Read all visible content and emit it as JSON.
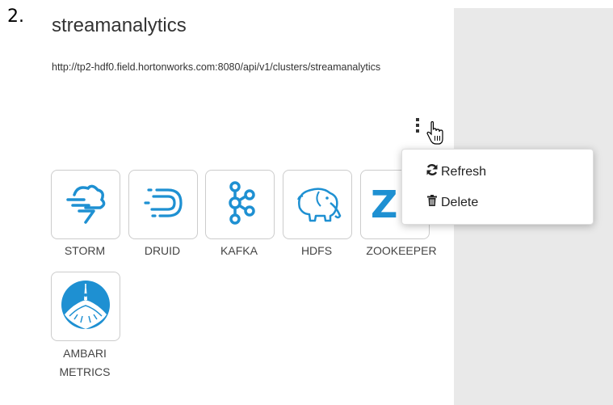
{
  "step_number": "2.",
  "cluster": {
    "name": "streamanalytics",
    "url": "http://tp2-hdf0.field.hortonworks.com:8080/api/v1/clusters/streamanalytics"
  },
  "menu": {
    "items": [
      {
        "label": "Refresh",
        "icon": "refresh-icon"
      },
      {
        "label": "Delete",
        "icon": "trash-icon"
      }
    ]
  },
  "services": [
    {
      "label": "STORM",
      "icon": "storm-icon"
    },
    {
      "label": "DRUID",
      "icon": "druid-icon"
    },
    {
      "label": "KAFKA",
      "icon": "kafka-icon"
    },
    {
      "label": "HDFS",
      "icon": "hdfs-elephant-icon"
    },
    {
      "label": "ZOOKEEPER",
      "icon": "zookeeper-icon",
      "logo_text": "ZK"
    },
    {
      "label_line1": "AMBARI",
      "label_line2": "METRICS",
      "icon": "ambari-metrics-icon"
    }
  ],
  "colors": {
    "brand_blue": "#1e90d2",
    "panel_gray": "#e9e9e9"
  }
}
